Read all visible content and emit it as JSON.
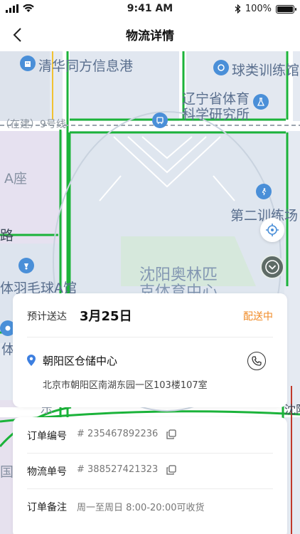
{
  "status_bar": {
    "time": "9:41 AM",
    "battery": "100%"
  },
  "nav": {
    "title": "物流详情"
  },
  "map": {
    "labels": {
      "tsinghua": "清华同方信息港",
      "ball_training": "球类训练馆",
      "liaoning_1": "辽宁省体育",
      "liaoning_2": "科学研究所",
      "metro_line": "（在建）9号线",
      "a_zuo": "A座",
      "lu": "路",
      "training2": "第二训练场",
      "badminton": "体羽毛球A馆",
      "olympic_1": "沈阳奥林匹",
      "olympic_2": "克体育中心",
      "ti": "体",
      "guo": "国际",
      "dong": "东",
      "shen": "沈阳"
    }
  },
  "delivery": {
    "eta_label": "预计送达",
    "eta_date": "3月25日",
    "status": "配送中",
    "warehouse": "朝阳区仓储中心",
    "address": "北京市朝阳区南湖东园一区103楼107室"
  },
  "order": {
    "order_no_label": "订单编号",
    "order_no": "# 235467892236",
    "tracking_label": "物流单号",
    "tracking_no": "# 388527421323",
    "remark_label": "订单备注",
    "remark": "周一至周日 8:00-20:00可收货"
  },
  "colors": {
    "accent": "#f08a24",
    "map_road_green": "#1bb33a",
    "poi_blue": "#4a8fd8"
  }
}
